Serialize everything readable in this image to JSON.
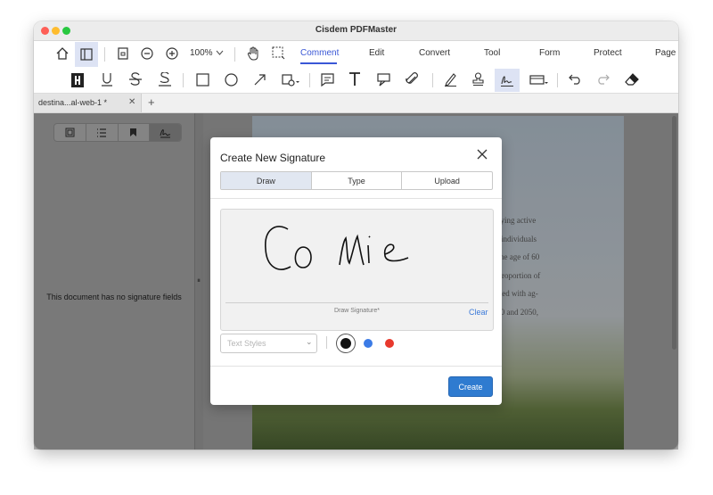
{
  "window": {
    "title": "Cisdem PDFMaster"
  },
  "toolbar": {
    "zoom": "100%",
    "menu_tabs": [
      "Comment",
      "Edit",
      "Convert",
      "Tool",
      "Form",
      "Protect",
      "Page"
    ],
    "active_tab": "Comment"
  },
  "tabs": {
    "doc_tab_label": "destina...al-web-1 *"
  },
  "sidebar": {
    "empty_message": "This document has no signature fields"
  },
  "page_text": [
    "globe, staying active",
    "-being of individuals",
    "ple over the age of 60",
    "a higher proportion of",
    "ft associated with ag-",
    "ween 1950 and 2050,"
  ],
  "dialog": {
    "title": "Create New Signature",
    "tabs": [
      "Draw",
      "Type",
      "Upload"
    ],
    "selected_tab": "Draw",
    "draw_caption": "Draw Signature*",
    "clear_label": "Clear",
    "text_styles_placeholder": "Text Styles",
    "create_label": "Create",
    "colors": [
      "#111111",
      "#3b7be6",
      "#e8392d"
    ],
    "selected_color": "#111111",
    "signature_text": "Connie"
  },
  "colors": {
    "accent": "#3a57d6",
    "button": "#2f7bd0"
  }
}
